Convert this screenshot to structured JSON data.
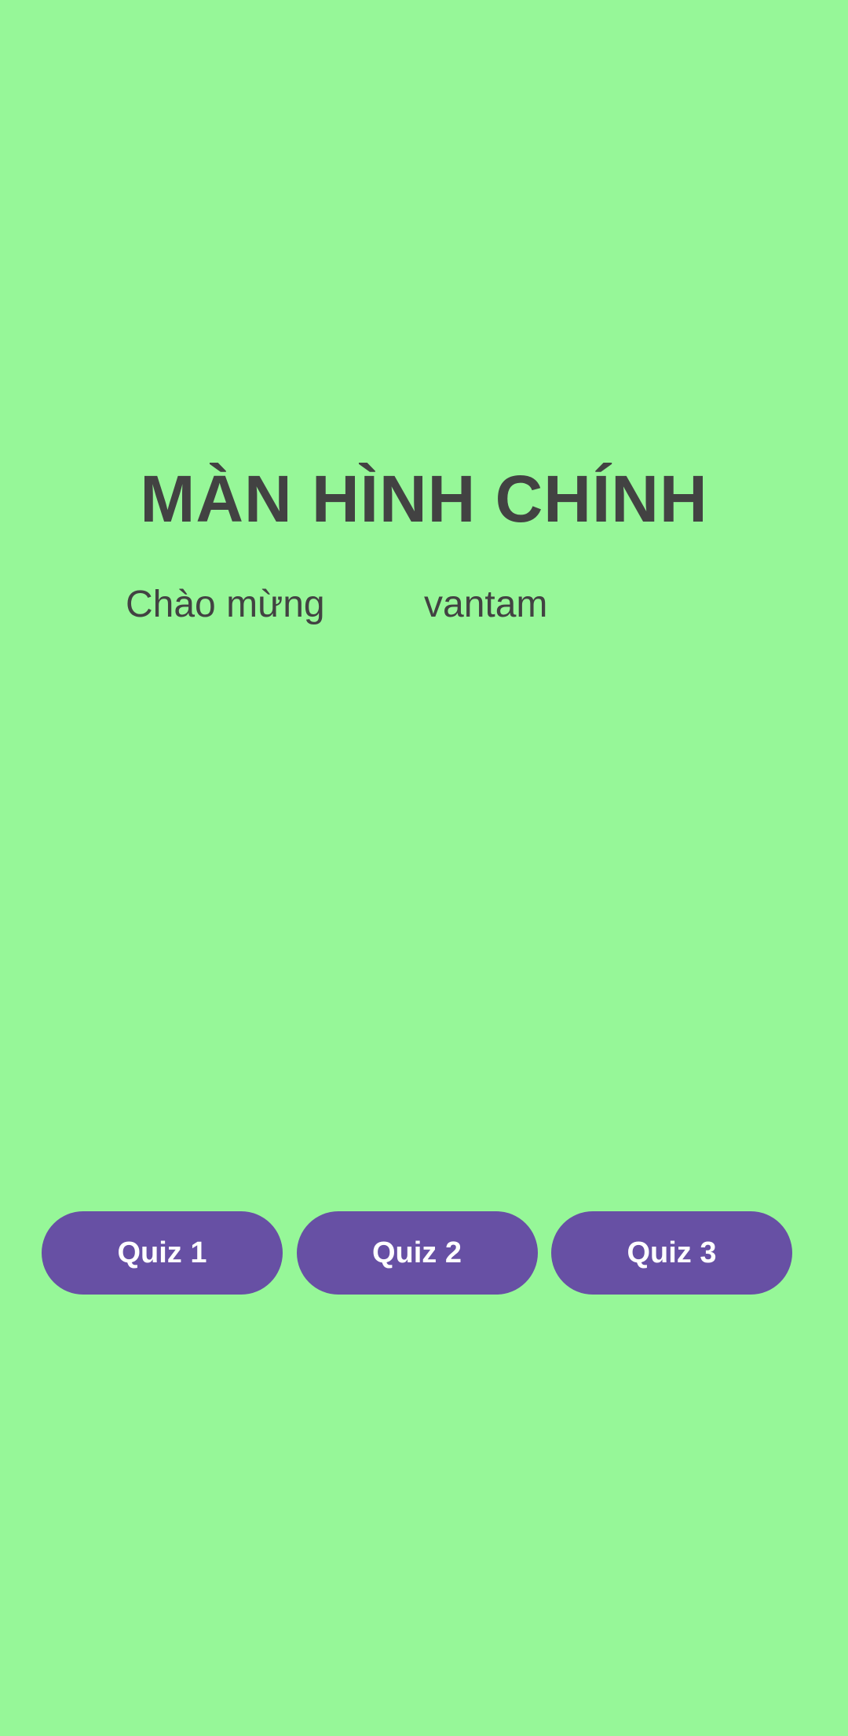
{
  "main": {
    "title": "MÀN HÌNH CHÍNH",
    "welcome_label": "Chào mừng",
    "username": "vantam"
  },
  "quiz_buttons": [
    {
      "label": "Quiz 1"
    },
    {
      "label": "Quiz 2"
    },
    {
      "label": "Quiz 3"
    }
  ],
  "colors": {
    "background": "#96f798",
    "text": "#424242",
    "button_background": "#6750a4",
    "button_text": "#ffffff"
  }
}
